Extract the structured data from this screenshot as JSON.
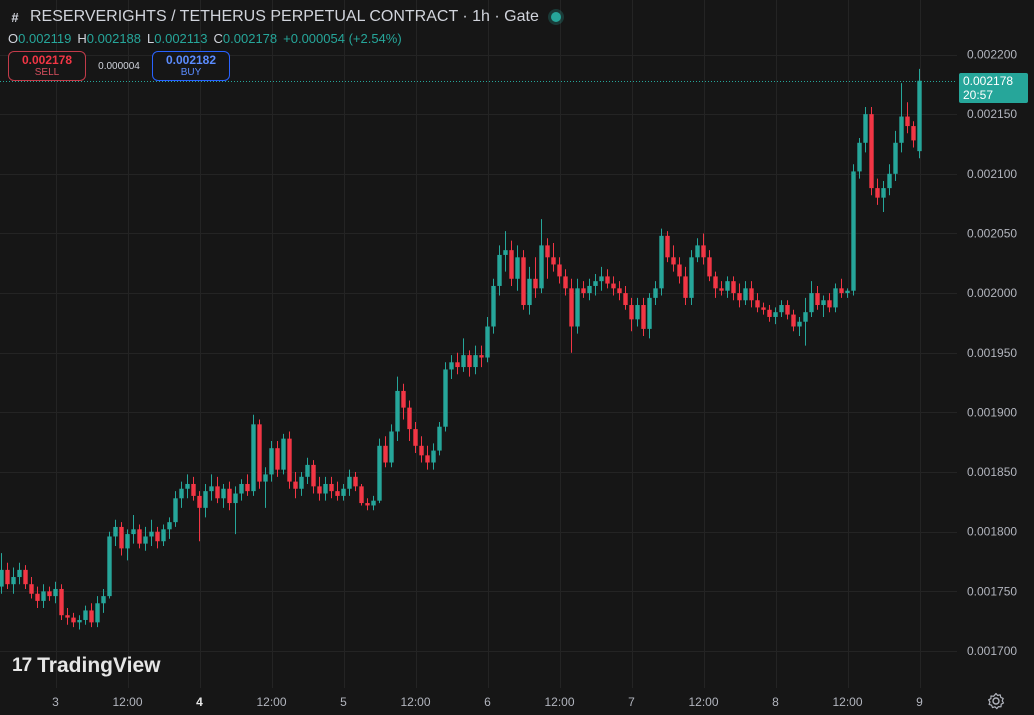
{
  "header": {
    "title": "RESERVERIGHTS / TETHERUS PERPETUAL CONTRACT · 1h · Gate",
    "ohlc": [
      {
        "label": "O",
        "value": "0.002119"
      },
      {
        "label": "H",
        "value": "0.002188"
      },
      {
        "label": "L",
        "value": "0.002113"
      },
      {
        "label": "C",
        "value": "0.002178"
      }
    ],
    "change": "+0.000054 (+2.54%)"
  },
  "trade": {
    "sell_price": "0.002178",
    "sell_label": "SELL",
    "spread": "0.000004",
    "buy_price": "0.002182",
    "buy_label": "BUY"
  },
  "last_price": {
    "value": "0.002178",
    "countdown": "20:57"
  },
  "brand": {
    "name": "TradingView"
  },
  "colors": {
    "up": "#26a69a",
    "down": "#f23645",
    "background": "#161616",
    "grid": "#242424",
    "axis_text": "#b2b5be"
  },
  "chart_data": {
    "type": "candlestick",
    "timeframe": "1h",
    "last_close": 0.002178,
    "ylim": [
      0.00168,
      0.00221
    ],
    "grid": true,
    "y_ticks": [
      "0.002200",
      "0.002150",
      "0.002100",
      "0.002050",
      "0.002000",
      "0.001950",
      "0.001900",
      "0.001850",
      "0.001800",
      "0.001750",
      "0.001700"
    ],
    "x_ticks": [
      {
        "index": 9,
        "label": "3",
        "bold": false
      },
      {
        "index": 21,
        "label": "12:00",
        "bold": false
      },
      {
        "index": 33,
        "label": "4",
        "bold": true
      },
      {
        "index": 45,
        "label": "12:00",
        "bold": false
      },
      {
        "index": 57,
        "label": "5",
        "bold": false
      },
      {
        "index": 69,
        "label": "12:00",
        "bold": false
      },
      {
        "index": 81,
        "label": "6",
        "bold": false
      },
      {
        "index": 93,
        "label": "12:00",
        "bold": false
      },
      {
        "index": 105,
        "label": "7",
        "bold": false
      },
      {
        "index": 117,
        "label": "12:00",
        "bold": false
      },
      {
        "index": 129,
        "label": "8",
        "bold": false
      },
      {
        "index": 141,
        "label": "12:00",
        "bold": false
      },
      {
        "index": 153,
        "label": "9",
        "bold": false
      }
    ],
    "ohlc": [
      [
        0.001754,
        0.001782,
        0.001748,
        0.001768
      ],
      [
        0.001768,
        0.001774,
        0.001752,
        0.001756
      ],
      [
        0.001756,
        0.00177,
        0.001748,
        0.001762
      ],
      [
        0.001762,
        0.001774,
        0.001756,
        0.001768
      ],
      [
        0.001768,
        0.001772,
        0.001752,
        0.001756
      ],
      [
        0.001756,
        0.001762,
        0.001744,
        0.001748
      ],
      [
        0.001748,
        0.001754,
        0.001736,
        0.001742
      ],
      [
        0.001742,
        0.001756,
        0.001736,
        0.00175
      ],
      [
        0.00175,
        0.001754,
        0.001742,
        0.001746
      ],
      [
        0.001746,
        0.001758,
        0.00174,
        0.001752
      ],
      [
        0.001752,
        0.001756,
        0.001726,
        0.00173
      ],
      [
        0.00173,
        0.001736,
        0.001722,
        0.001728
      ],
      [
        0.001728,
        0.001732,
        0.00172,
        0.001724
      ],
      [
        0.001724,
        0.00173,
        0.001718,
        0.001726
      ],
      [
        0.001726,
        0.001738,
        0.001722,
        0.001734
      ],
      [
        0.001734,
        0.00174,
        0.00172,
        0.001724
      ],
      [
        0.001724,
        0.001746,
        0.00172,
        0.00174
      ],
      [
        0.00174,
        0.001752,
        0.001732,
        0.001746
      ],
      [
        0.001746,
        0.0018,
        0.001744,
        0.001796
      ],
      [
        0.001796,
        0.00181,
        0.001788,
        0.001804
      ],
      [
        0.001804,
        0.001808,
        0.00178,
        0.001786
      ],
      [
        0.001786,
        0.001802,
        0.001776,
        0.001798
      ],
      [
        0.001798,
        0.001814,
        0.00179,
        0.001802
      ],
      [
        0.001802,
        0.001806,
        0.001786,
        0.00179
      ],
      [
        0.00179,
        0.001804,
        0.001784,
        0.001796
      ],
      [
        0.001796,
        0.00181,
        0.001788,
        0.0018
      ],
      [
        0.0018,
        0.001804,
        0.001786,
        0.001792
      ],
      [
        0.001792,
        0.001806,
        0.001788,
        0.001802
      ],
      [
        0.001802,
        0.001812,
        0.001794,
        0.001808
      ],
      [
        0.001808,
        0.001834,
        0.001804,
        0.001828
      ],
      [
        0.001828,
        0.001842,
        0.00182,
        0.001836
      ],
      [
        0.001836,
        0.001848,
        0.001828,
        0.00184
      ],
      [
        0.00184,
        0.001846,
        0.001826,
        0.00183
      ],
      [
        0.00183,
        0.001834,
        0.001792,
        0.00182
      ],
      [
        0.00182,
        0.00184,
        0.001812,
        0.001834
      ],
      [
        0.001834,
        0.001848,
        0.001826,
        0.001838
      ],
      [
        0.001838,
        0.001846,
        0.001824,
        0.001828
      ],
      [
        0.001828,
        0.00184,
        0.00182,
        0.001836
      ],
      [
        0.001836,
        0.001842,
        0.001818,
        0.001824
      ],
      [
        0.001824,
        0.001838,
        0.001798,
        0.001832
      ],
      [
        0.001832,
        0.001844,
        0.001826,
        0.00184
      ],
      [
        0.00184,
        0.001848,
        0.00183,
        0.001834
      ],
      [
        0.001834,
        0.001898,
        0.00183,
        0.00189
      ],
      [
        0.00189,
        0.001894,
        0.001836,
        0.001842
      ],
      [
        0.001842,
        0.001854,
        0.00182,
        0.001848
      ],
      [
        0.001848,
        0.001876,
        0.001842,
        0.00187
      ],
      [
        0.00187,
        0.001876,
        0.001846,
        0.001852
      ],
      [
        0.001852,
        0.001882,
        0.001848,
        0.001878
      ],
      [
        0.001878,
        0.001884,
        0.001836,
        0.001842
      ],
      [
        0.001842,
        0.00185,
        0.001828,
        0.001836
      ],
      [
        0.001836,
        0.00185,
        0.00183,
        0.001846
      ],
      [
        0.001846,
        0.001862,
        0.00184,
        0.001856
      ],
      [
        0.001856,
        0.00186,
        0.001832,
        0.001838
      ],
      [
        0.001838,
        0.001846,
        0.001826,
        0.001832
      ],
      [
        0.001832,
        0.001846,
        0.001826,
        0.00184
      ],
      [
        0.00184,
        0.001846,
        0.001828,
        0.001834
      ],
      [
        0.001834,
        0.001842,
        0.001826,
        0.00183
      ],
      [
        0.00183,
        0.00184,
        0.001826,
        0.001836
      ],
      [
        0.001836,
        0.001852,
        0.00183,
        0.001846
      ],
      [
        0.001846,
        0.00185,
        0.001834,
        0.001838
      ],
      [
        0.001838,
        0.00184,
        0.001822,
        0.001824
      ],
      [
        0.001824,
        0.001828,
        0.001818,
        0.001822
      ],
      [
        0.001822,
        0.00183,
        0.001818,
        0.001826
      ],
      [
        0.001826,
        0.001878,
        0.001824,
        0.001872
      ],
      [
        0.001872,
        0.00188,
        0.001854,
        0.001858
      ],
      [
        0.001858,
        0.00189,
        0.001854,
        0.001884
      ],
      [
        0.001884,
        0.00193,
        0.001876,
        0.001918
      ],
      [
        0.001918,
        0.001924,
        0.001894,
        0.001904
      ],
      [
        0.001904,
        0.00191,
        0.001876,
        0.001886
      ],
      [
        0.001886,
        0.001892,
        0.001866,
        0.001872
      ],
      [
        0.001872,
        0.00188,
        0.001858,
        0.001864
      ],
      [
        0.001864,
        0.001872,
        0.001852,
        0.001858
      ],
      [
        0.001858,
        0.001874,
        0.001852,
        0.001868
      ],
      [
        0.001868,
        0.001892,
        0.001864,
        0.001888
      ],
      [
        0.001888,
        0.001942,
        0.001884,
        0.001936
      ],
      [
        0.001936,
        0.001948,
        0.001928,
        0.001942
      ],
      [
        0.001942,
        0.00195,
        0.001932,
        0.001938
      ],
      [
        0.001938,
        0.001962,
        0.001934,
        0.001948
      ],
      [
        0.001948,
        0.001952,
        0.00193,
        0.001938
      ],
      [
        0.001938,
        0.001956,
        0.001932,
        0.001948
      ],
      [
        0.001948,
        0.001956,
        0.001938,
        0.001946
      ],
      [
        0.001946,
        0.00198,
        0.001942,
        0.001972
      ],
      [
        0.001972,
        0.002012,
        0.001966,
        0.002006
      ],
      [
        0.002006,
        0.00204,
        0.001998,
        0.002032
      ],
      [
        0.002032,
        0.002052,
        0.002018,
        0.002036
      ],
      [
        0.002036,
        0.002044,
        0.002006,
        0.002012
      ],
      [
        0.002012,
        0.00204,
        0.002002,
        0.00203
      ],
      [
        0.00203,
        0.002036,
        0.001986,
        0.00199
      ],
      [
        0.00199,
        0.002022,
        0.001982,
        0.002012
      ],
      [
        0.002012,
        0.00203,
        0.001996,
        0.002004
      ],
      [
        0.002004,
        0.002062,
        0.002,
        0.00204
      ],
      [
        0.00204,
        0.002046,
        0.002012,
        0.00203
      ],
      [
        0.00203,
        0.002042,
        0.002018,
        0.002024
      ],
      [
        0.002024,
        0.00203,
        0.002008,
        0.002014
      ],
      [
        0.002014,
        0.00202,
        0.001998,
        0.002004
      ],
      [
        0.002004,
        0.002012,
        0.00195,
        0.001972
      ],
      [
        0.001972,
        0.002012,
        0.001966,
        0.002004
      ],
      [
        0.002004,
        0.00201,
        0.001996,
        0.002
      ],
      [
        0.002,
        0.002012,
        0.001994,
        0.002006
      ],
      [
        0.002006,
        0.002016,
        0.001998,
        0.00201
      ],
      [
        0.00201,
        0.002022,
        0.002002,
        0.002014
      ],
      [
        0.002014,
        0.00202,
        0.002004,
        0.002008
      ],
      [
        0.002008,
        0.002014,
        0.001998,
        0.002004
      ],
      [
        0.002004,
        0.00201,
        0.001994,
        0.002
      ],
      [
        0.002,
        0.002006,
        0.001986,
        0.00199
      ],
      [
        0.00199,
        0.001996,
        0.001968,
        0.001978
      ],
      [
        0.001978,
        0.001996,
        0.001972,
        0.00199
      ],
      [
        0.00199,
        0.001996,
        0.001964,
        0.00197
      ],
      [
        0.00197,
        0.002,
        0.001962,
        0.001996
      ],
      [
        0.001996,
        0.00201,
        0.00199,
        0.002004
      ],
      [
        0.002004,
        0.002054,
        0.001998,
        0.002048
      ],
      [
        0.002048,
        0.002052,
        0.002026,
        0.00203
      ],
      [
        0.00203,
        0.00204,
        0.002018,
        0.002024
      ],
      [
        0.002024,
        0.00203,
        0.002008,
        0.002014
      ],
      [
        0.002014,
        0.002022,
        0.00199,
        0.001996
      ],
      [
        0.001996,
        0.002036,
        0.00199,
        0.00203
      ],
      [
        0.00203,
        0.002046,
        0.002026,
        0.00204
      ],
      [
        0.00204,
        0.00205,
        0.002024,
        0.00203
      ],
      [
        0.00203,
        0.002036,
        0.00201,
        0.002014
      ],
      [
        0.002014,
        0.002018,
        0.001996,
        0.002004
      ],
      [
        0.002004,
        0.00201,
        0.001998,
        0.002002
      ],
      [
        0.002002,
        0.002014,
        0.001996,
        0.00201
      ],
      [
        0.00201,
        0.002014,
        0.001994,
        0.002
      ],
      [
        0.002,
        0.002008,
        0.001988,
        0.001994
      ],
      [
        0.001994,
        0.00201,
        0.00199,
        0.002004
      ],
      [
        0.002004,
        0.00201,
        0.001988,
        0.001994
      ],
      [
        0.001994,
        0.002,
        0.001984,
        0.001988
      ],
      [
        0.001988,
        0.001992,
        0.001982,
        0.001986
      ],
      [
        0.001986,
        0.00199,
        0.001976,
        0.00198
      ],
      [
        0.00198,
        0.001988,
        0.001974,
        0.001984
      ],
      [
        0.001984,
        0.001994,
        0.00198,
        0.00199
      ],
      [
        0.00199,
        0.001994,
        0.001978,
        0.001982
      ],
      [
        0.001982,
        0.001986,
        0.001968,
        0.001972
      ],
      [
        0.001972,
        0.00198,
        0.001964,
        0.001976
      ],
      [
        0.001976,
        0.001996,
        0.001956,
        0.001984
      ],
      [
        0.001984,
        0.00201,
        0.00198,
        0.002
      ],
      [
        0.002,
        0.002006,
        0.001986,
        0.00199
      ],
      [
        0.00199,
        0.001998,
        0.00198,
        0.001994
      ],
      [
        0.001994,
        0.002,
        0.001984,
        0.001988
      ],
      [
        0.001988,
        0.002008,
        0.001984,
        0.002004
      ],
      [
        0.002004,
        0.002012,
        0.001996,
        0.002
      ],
      [
        0.002,
        0.002004,
        0.001996,
        0.002002
      ],
      [
        0.002002,
        0.002108,
        0.001998,
        0.002102
      ],
      [
        0.002102,
        0.00213,
        0.002096,
        0.002126
      ],
      [
        0.002126,
        0.002156,
        0.002118,
        0.00215
      ],
      [
        0.00215,
        0.002156,
        0.002082,
        0.002088
      ],
      [
        0.002088,
        0.002096,
        0.002074,
        0.00208
      ],
      [
        0.00208,
        0.002094,
        0.002068,
        0.002088
      ],
      [
        0.002088,
        0.002108,
        0.002082,
        0.0021
      ],
      [
        0.0021,
        0.002136,
        0.002094,
        0.002126
      ],
      [
        0.002126,
        0.002176,
        0.002118,
        0.002148
      ],
      [
        0.002148,
        0.00216,
        0.002134,
        0.00214
      ],
      [
        0.00214,
        0.002144,
        0.002122,
        0.002128
      ],
      [
        0.002119,
        0.002188,
        0.002113,
        0.002178
      ]
    ]
  }
}
